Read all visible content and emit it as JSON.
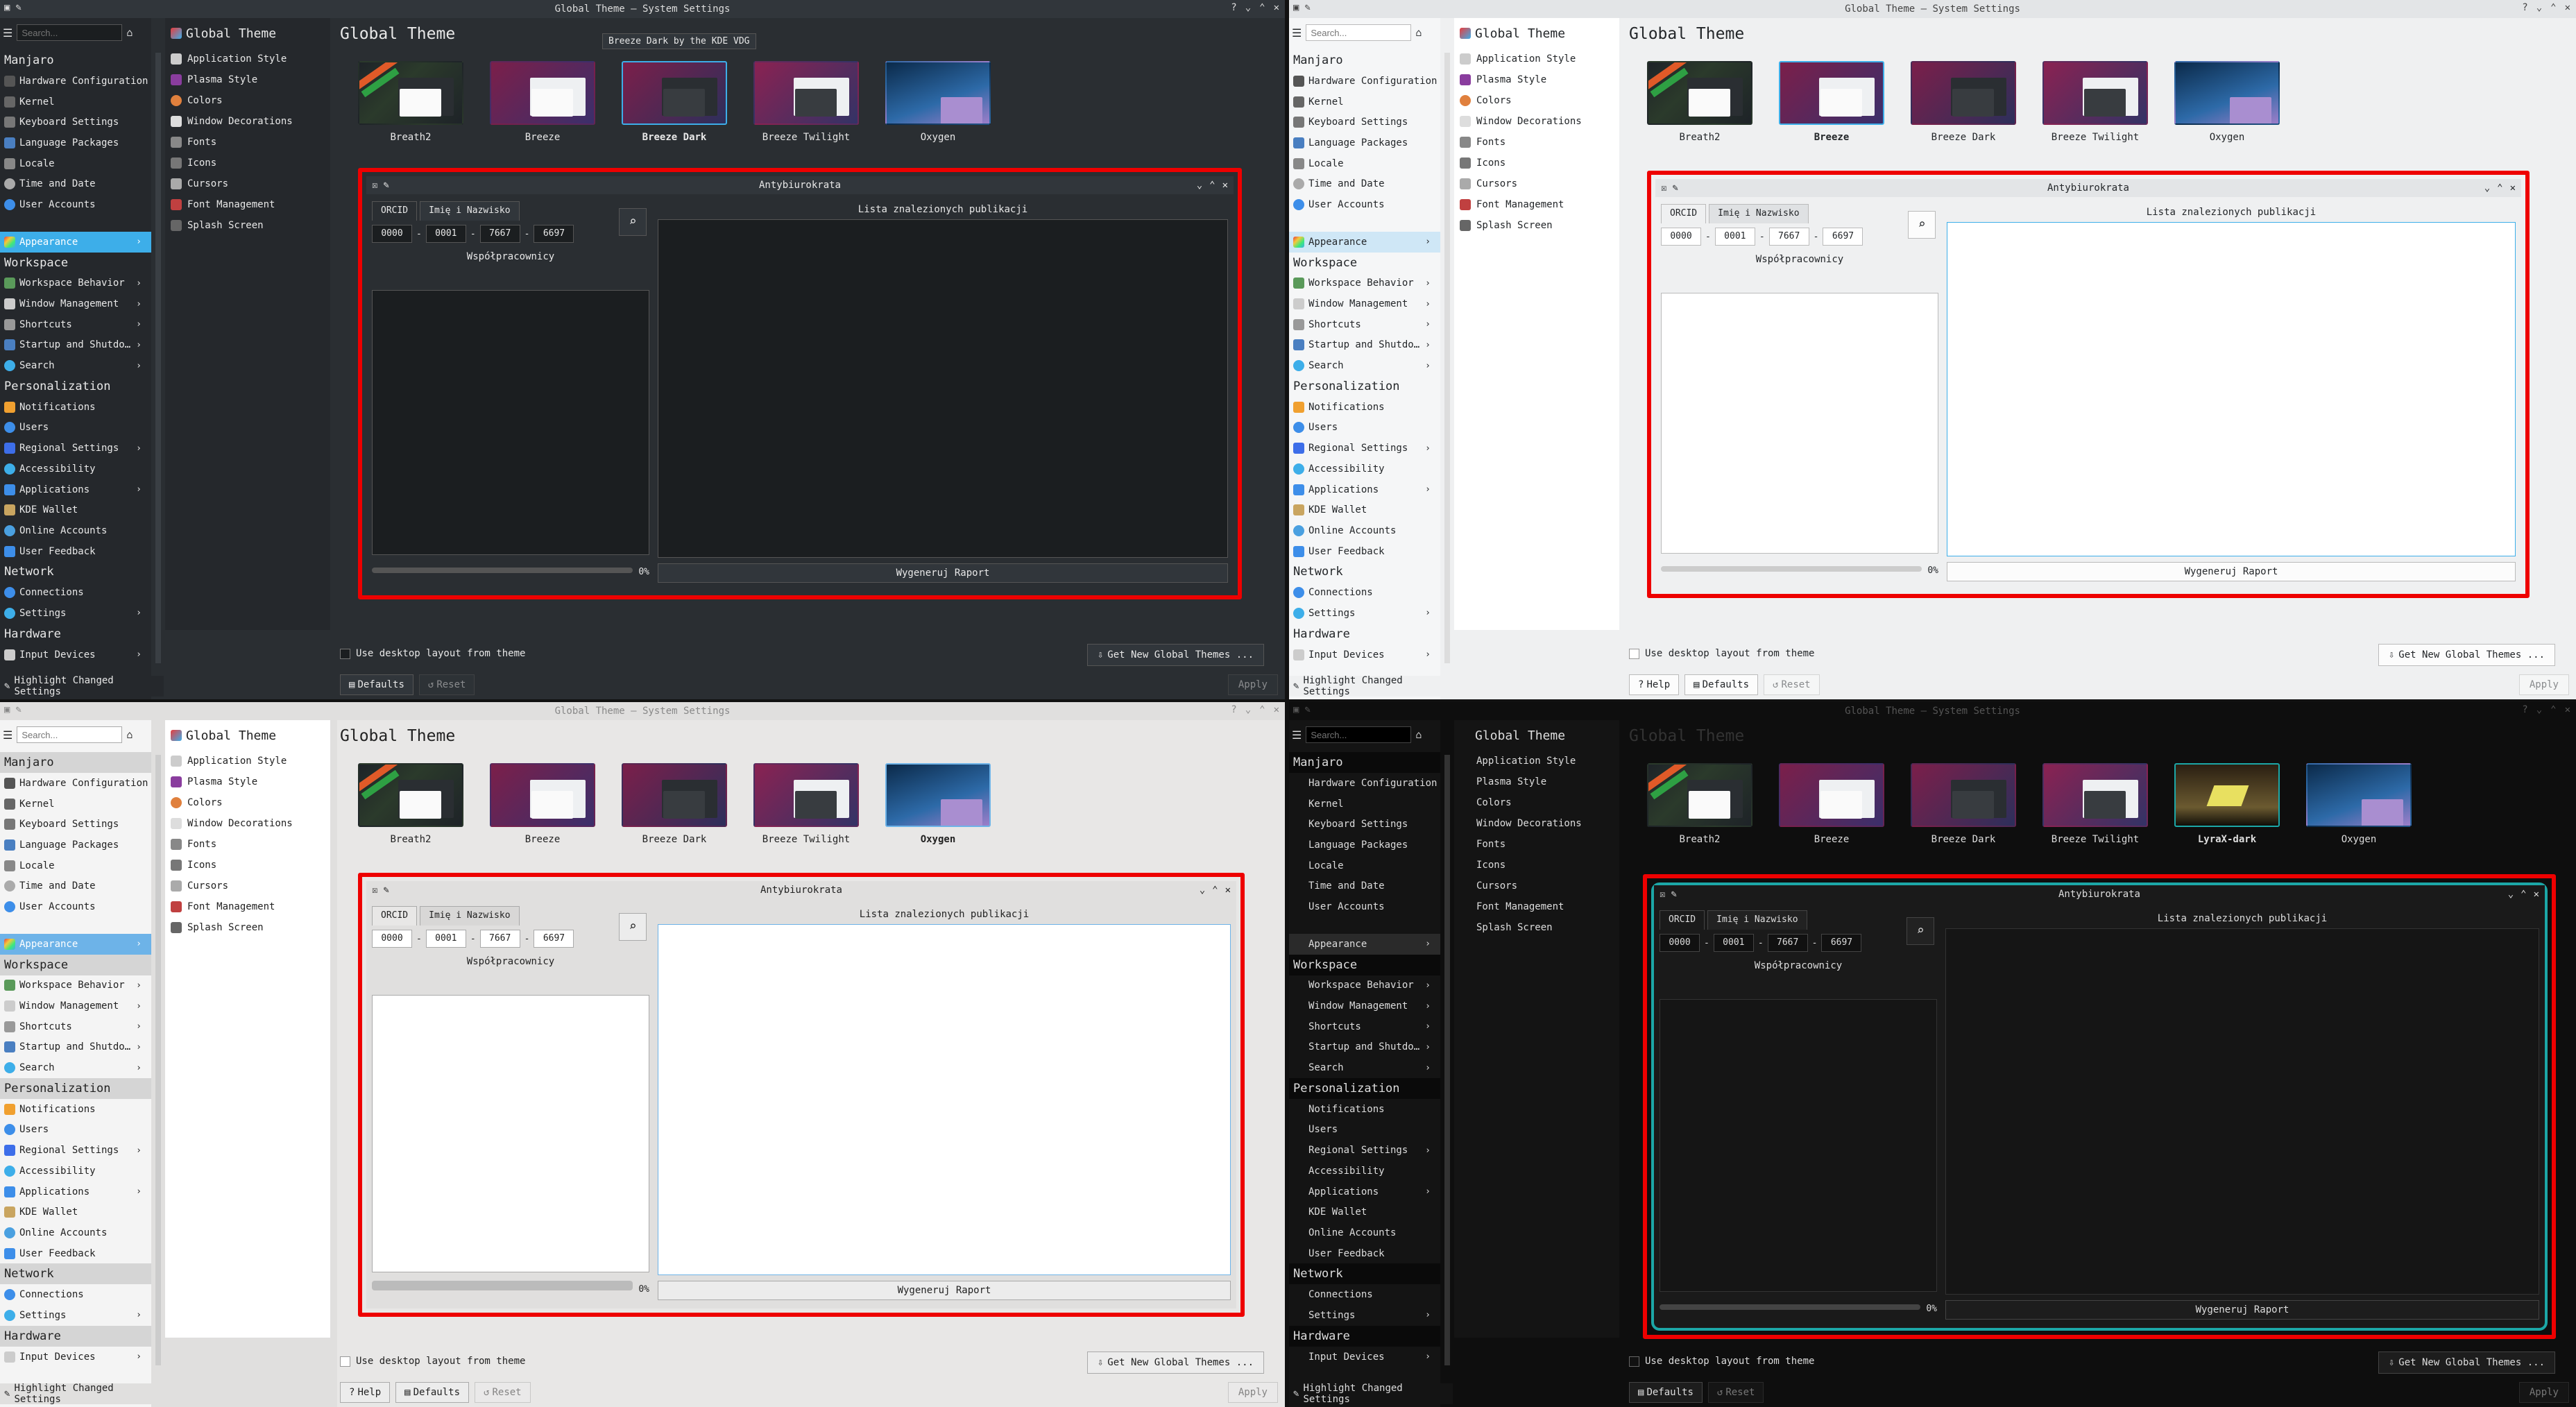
{
  "window_title": "Global Theme — System Settings",
  "sidebar": {
    "search_placeholder": "Search...",
    "categories": {
      "manjaro": "Manjaro",
      "workspace": "Workspace",
      "personalization": "Personalization",
      "network": "Network",
      "hardware": "Hardware"
    },
    "manjaro_items": [
      "Hardware Configuration",
      "Kernel",
      "Keyboard Settings",
      "Language Packages",
      "Locale",
      "Time and Date",
      "User Accounts"
    ],
    "appearance": "Appearance",
    "workspace_items": [
      "Workspace Behavior",
      "Window Management",
      "Shortcuts",
      "Startup and Shutdo…",
      "Search"
    ],
    "personalization_items": [
      "Notifications",
      "Users",
      "Regional Settings",
      "Accessibility",
      "Applications",
      "KDE Wallet",
      "Online Accounts",
      "User Feedback"
    ],
    "network_items": [
      "Connections",
      "Settings"
    ],
    "hardware_items": [
      "Input Devices"
    ],
    "highlight": "Highlight Changed Settings"
  },
  "middle": {
    "header": "Global Theme",
    "items": [
      "Application Style",
      "Plasma Style",
      "Colors",
      "Window Decorations",
      "Fonts",
      "Icons",
      "Cursors",
      "Font Management",
      "Splash Screen"
    ]
  },
  "main": {
    "title": "Global Theme",
    "themes": [
      "Breath2",
      "Breeze",
      "Breeze Dark",
      "Breeze Twilight",
      "Oxygen"
    ],
    "lyrax_theme": "LyraX-dark",
    "tooltip": "Breeze Dark by the KDE VDG",
    "use_layout": "Use desktop layout from theme",
    "get_new": "Get New Global Themes ...",
    "help": "Help",
    "defaults": "Defaults",
    "reset": "Reset",
    "apply": "Apply"
  },
  "app": {
    "title": "Antybiurokrata",
    "tab_orcid": "ORCID",
    "tab_name": "Imię i Nazwisko",
    "orcid_parts": [
      "0000",
      "0001",
      "7667",
      "6697"
    ],
    "dash": "-",
    "coworkers": "Współpracownicy",
    "publications": "Lista znalezionych publikacji",
    "progress": "0%",
    "generate": "Wygeneruj Raport"
  },
  "colors": {
    "highlight_box": "#ee0000",
    "breeze_accent": "#3daee9",
    "lyrax_accent": "#1ca7a7"
  }
}
